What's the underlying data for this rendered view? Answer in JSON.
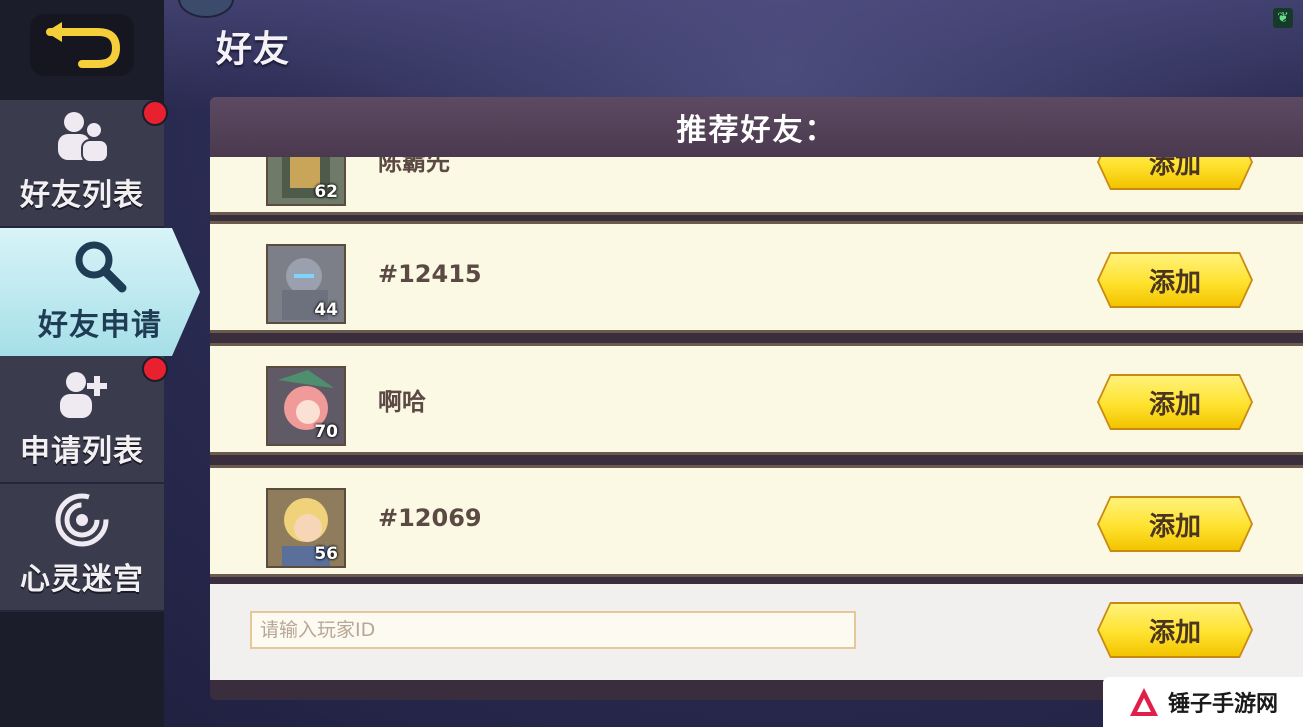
{
  "header": {
    "title": "好友"
  },
  "sidebar": {
    "items": [
      {
        "label": "好友列表",
        "icon": "friends-icon",
        "has_badge": true
      },
      {
        "label": "好友申请",
        "icon": "search-icon",
        "active": true
      },
      {
        "label": "申请列表",
        "icon": "add-user-icon",
        "has_badge": true
      },
      {
        "label": "心灵迷宫",
        "icon": "maze-icon"
      }
    ]
  },
  "panel": {
    "title": "推荐好友：",
    "rows": [
      {
        "name": "陈霸先",
        "level": "62",
        "button": "添加"
      },
      {
        "name": "#12415",
        "level": "44",
        "button": "添加"
      },
      {
        "name": "啊哈",
        "level": "70",
        "button": "添加"
      },
      {
        "name": "#12069",
        "level": "56",
        "button": "添加"
      }
    ],
    "input": {
      "placeholder": "请输入玩家ID",
      "value": ""
    },
    "input_button": "添加"
  },
  "watermark": {
    "text": "锤子手游网"
  },
  "colors": {
    "button_yellow": "#ffe22f",
    "badge_red": "#e8202f",
    "active_tab": "#bfe9ef"
  }
}
